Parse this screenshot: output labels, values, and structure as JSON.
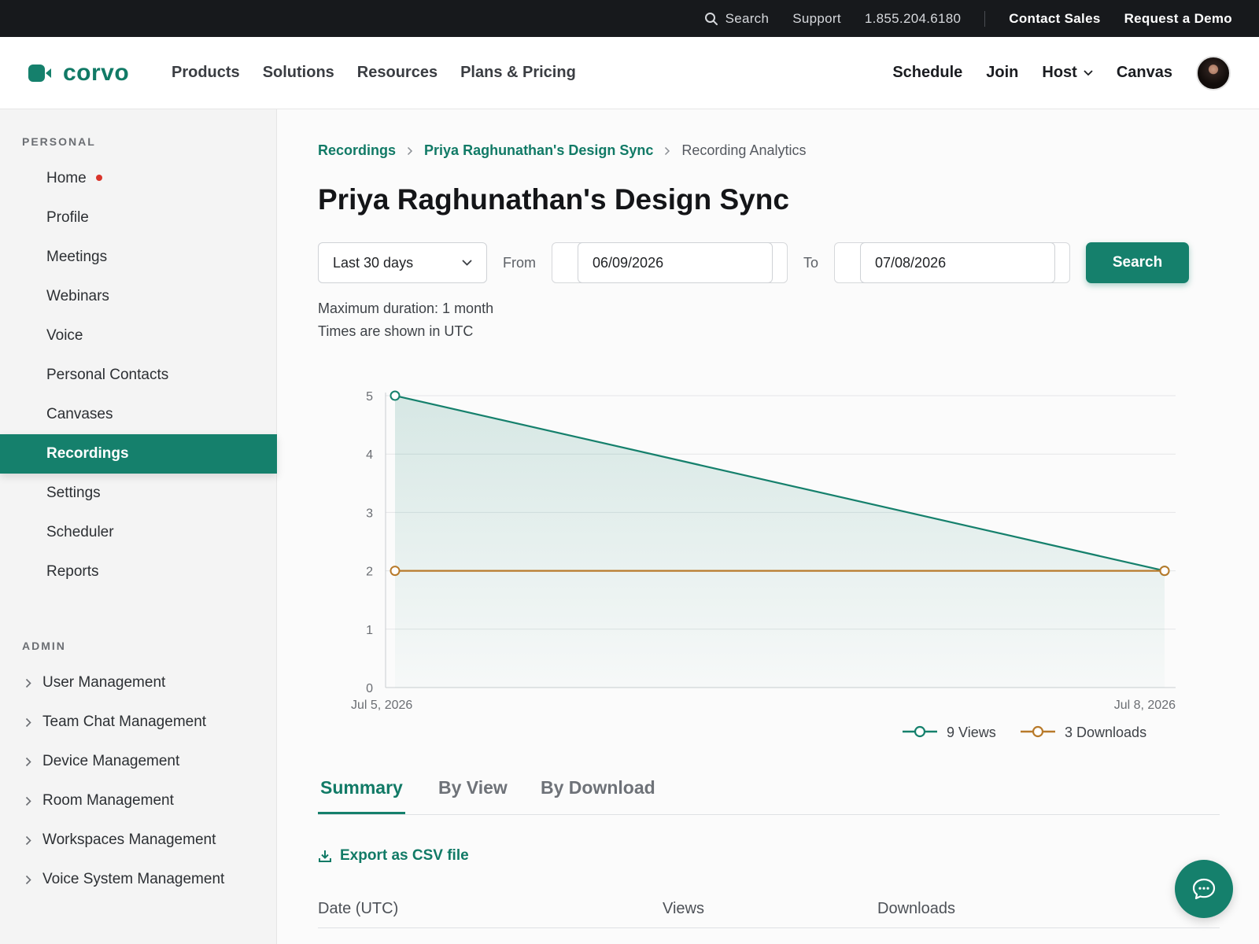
{
  "topbar": {
    "search_label": "Search",
    "support_label": "Support",
    "phone": "1.855.204.6180",
    "contact_sales": "Contact Sales",
    "request_demo": "Request a Demo"
  },
  "brand": {
    "name": "corvo",
    "color": "#15806c"
  },
  "nav": {
    "left": [
      "Products",
      "Solutions",
      "Resources",
      "Plans & Pricing"
    ],
    "schedule": "Schedule",
    "join": "Join",
    "host": "Host",
    "canvas": "Canvas"
  },
  "sidebar": {
    "personal_title": "PERSONAL",
    "personal_items": [
      "Home",
      "Profile",
      "Meetings",
      "Webinars",
      "Voice",
      "Personal Contacts",
      "Canvases",
      "Recordings",
      "Settings",
      "Scheduler",
      "Reports"
    ],
    "active_item": "Recordings",
    "admin_title": "ADMIN",
    "admin_items": [
      "User Management",
      "Team Chat Management",
      "Device Management",
      "Room Management",
      "Workspaces Management",
      "Voice System Management"
    ]
  },
  "breadcrumb": {
    "root": "Recordings",
    "meeting": "Priya Raghunathan's Design Sync",
    "current": "Recording Analytics"
  },
  "page_title": "Priya Raghunathan's Design Sync",
  "filters": {
    "range_selected": "Last 30 days",
    "from_label": "From",
    "from_value": "06/09/2026",
    "to_label": "To",
    "to_value": "07/08/2026",
    "search_button": "Search"
  },
  "notes": {
    "max_duration": "Maximum duration: 1 month",
    "timezone": "Times are shown in UTC"
  },
  "chart_data": {
    "type": "line",
    "x": [
      "Jul 5, 2026",
      "Jul 8, 2026"
    ],
    "series": [
      {
        "name": "9 Views",
        "values": [
          5,
          2
        ],
        "color": "#15806c",
        "filled": true
      },
      {
        "name": "3 Downloads",
        "values": [
          2,
          2
        ],
        "color": "#b87a2a",
        "filled": false
      }
    ],
    "ylim": [
      0,
      5
    ],
    "yticks": [
      0,
      1,
      2,
      3,
      4,
      5
    ],
    "grid": true,
    "legend_position": "bottom-right"
  },
  "tabs": [
    "Summary",
    "By View",
    "By Download"
  ],
  "active_tab": "Summary",
  "export_label": "Export as CSV file",
  "table": {
    "columns": [
      "Date (UTC)",
      "Views",
      "Downloads"
    ]
  }
}
